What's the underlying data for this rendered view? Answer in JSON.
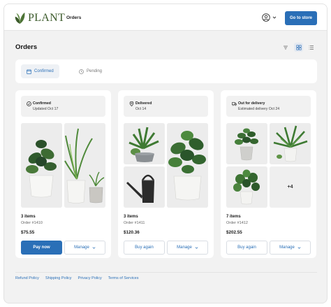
{
  "brand": {
    "name": "PLANT",
    "color": "#3b5a2a"
  },
  "header": {
    "nav_orders": "Orders",
    "profile_icon": "user-circle-icon",
    "store_button": "Go to store",
    "accent": "#2a6fb7"
  },
  "page": {
    "title": "Orders"
  },
  "toolbar": {
    "filter_icon": "filter-icon",
    "grid_icon": "grid-view-icon",
    "list_icon": "list-view-icon",
    "active_view": "grid"
  },
  "tabs": [
    {
      "label": "Confirmed",
      "icon": "calendar-icon",
      "active": true
    },
    {
      "label": "Pending",
      "icon": "clock-icon",
      "active": false
    }
  ],
  "orders": [
    {
      "status": "Confirmed",
      "status_icon": "check-circle-icon",
      "status_detail": "Updated Oct 17",
      "items": "3 items",
      "order_number": "Order #1410",
      "total": "$75.55",
      "primary_action": "Pay now",
      "manage_label": "Manage"
    },
    {
      "status": "Delivered",
      "status_icon": "location-pin-icon",
      "status_detail": "Oct 14",
      "items": "3 items",
      "order_number": "Order #1411",
      "total": "$120.36",
      "primary_action": "Buy again",
      "manage_label": "Manage"
    },
    {
      "status": "Out for delivery",
      "status_icon": "truck-icon",
      "status_detail": "Estimated delivery Oct 24",
      "items": "7 items",
      "order_number": "Order #1412",
      "total": "$202.55",
      "primary_action": "Buy again",
      "manage_label": "Manage",
      "more_images": "+4"
    }
  ],
  "footer": {
    "links": [
      "Refund Policy",
      "Shipping Policy",
      "Privacy Policy",
      "Terms of Services"
    ]
  }
}
